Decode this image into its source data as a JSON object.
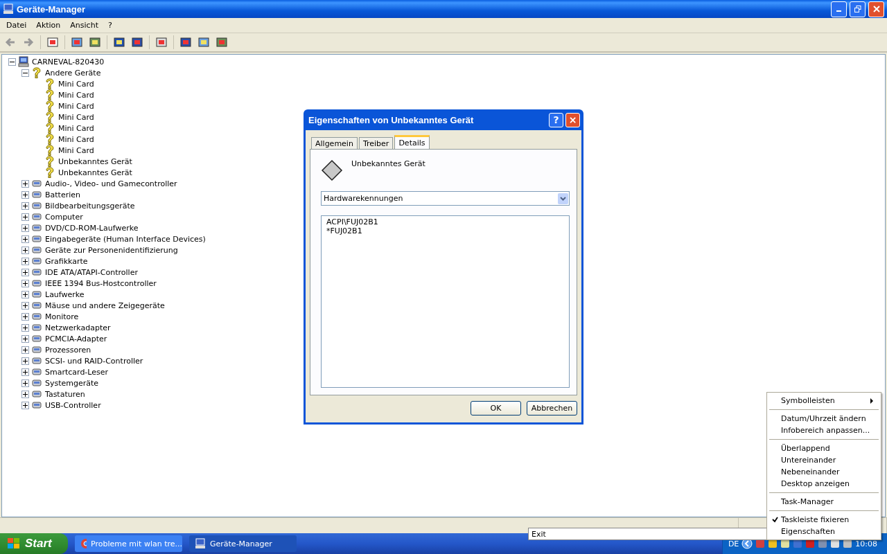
{
  "window": {
    "title": "Geräte-Manager"
  },
  "menu": [
    "Datei",
    "Aktion",
    "Ansicht",
    "?"
  ],
  "tree": {
    "label": "CARNEVAL-820430",
    "expanded": true,
    "children": [
      {
        "label": "Andere Geräte",
        "expanded": true,
        "children": [
          {
            "label": "Mini Card"
          },
          {
            "label": "Mini Card"
          },
          {
            "label": "Mini Card"
          },
          {
            "label": "Mini Card"
          },
          {
            "label": "Mini Card"
          },
          {
            "label": "Mini Card"
          },
          {
            "label": "Mini Card"
          },
          {
            "label": "Unbekanntes Gerät"
          },
          {
            "label": "Unbekanntes Gerät"
          }
        ]
      },
      {
        "label": "Audio-, Video- und Gamecontroller",
        "expanded": false
      },
      {
        "label": "Batterien",
        "expanded": false
      },
      {
        "label": "Bildbearbeitungsgeräte",
        "expanded": false
      },
      {
        "label": "Computer",
        "expanded": false
      },
      {
        "label": "DVD/CD-ROM-Laufwerke",
        "expanded": false
      },
      {
        "label": "Eingabegeräte (Human Interface Devices)",
        "expanded": false
      },
      {
        "label": "Geräte zur Personenidentifizierung",
        "expanded": false
      },
      {
        "label": "Grafikkarte",
        "expanded": false
      },
      {
        "label": "IDE ATA/ATAPI-Controller",
        "expanded": false
      },
      {
        "label": "IEEE 1394 Bus-Hostcontroller",
        "expanded": false
      },
      {
        "label": "Laufwerke",
        "expanded": false
      },
      {
        "label": "Mäuse und andere Zeigegeräte",
        "expanded": false
      },
      {
        "label": "Monitore",
        "expanded": false
      },
      {
        "label": "Netzwerkadapter",
        "expanded": false
      },
      {
        "label": "PCMCIA-Adapter",
        "expanded": false
      },
      {
        "label": "Prozessoren",
        "expanded": false
      },
      {
        "label": "SCSI- und RAID-Controller",
        "expanded": false
      },
      {
        "label": "Smartcard-Leser",
        "expanded": false
      },
      {
        "label": "Systemgeräte",
        "expanded": false
      },
      {
        "label": "Tastaturen",
        "expanded": false
      },
      {
        "label": "USB-Controller",
        "expanded": false
      }
    ]
  },
  "dialog": {
    "title": "Eigenschaften von Unbekanntes Gerät",
    "help_button": "?",
    "close_button": "×",
    "tabs": [
      {
        "label": "Allgemein",
        "selected": false
      },
      {
        "label": "Treiber",
        "selected": false
      },
      {
        "label": "Details",
        "selected": true
      }
    ],
    "device_name": "Unbekanntes Gerät",
    "property_select": "Hardwarekennungen",
    "values": [
      "ACPI\\FUJ02B1",
      "*FUJ02B1"
    ],
    "buttons": [
      "OK",
      "Abbrechen"
    ]
  },
  "popup": {
    "label": "Exit"
  },
  "context_menu": [
    {
      "kind": "item",
      "label": "Symbolleisten",
      "submenu": true,
      "checked": false
    },
    {
      "kind": "separator"
    },
    {
      "kind": "item",
      "label": "Datum/Uhrzeit ändern",
      "submenu": false,
      "checked": false
    },
    {
      "kind": "item",
      "label": "Infobereich anpassen...",
      "submenu": false,
      "checked": false
    },
    {
      "kind": "separator"
    },
    {
      "kind": "item",
      "label": "Überlappend",
      "submenu": false,
      "checked": false
    },
    {
      "kind": "item",
      "label": "Untereinander",
      "submenu": false,
      "checked": false
    },
    {
      "kind": "item",
      "label": "Nebeneinander",
      "submenu": false,
      "checked": false
    },
    {
      "kind": "item",
      "label": "Desktop anzeigen",
      "submenu": false,
      "checked": false
    },
    {
      "kind": "separator"
    },
    {
      "kind": "item",
      "label": "Task-Manager",
      "submenu": false,
      "checked": false
    },
    {
      "kind": "separator"
    },
    {
      "kind": "item",
      "label": "Taskleiste fixieren",
      "submenu": false,
      "checked": true
    },
    {
      "kind": "item",
      "label": "Eigenschaften",
      "submenu": false,
      "checked": false
    }
  ],
  "taskbar": {
    "start": "Start",
    "tasks": [
      {
        "label": "Probleme mit wlan tre...",
        "selected": false
      },
      {
        "label": "Geräte-Manager",
        "selected": true
      }
    ],
    "language": "DE",
    "clock": "10:08"
  }
}
